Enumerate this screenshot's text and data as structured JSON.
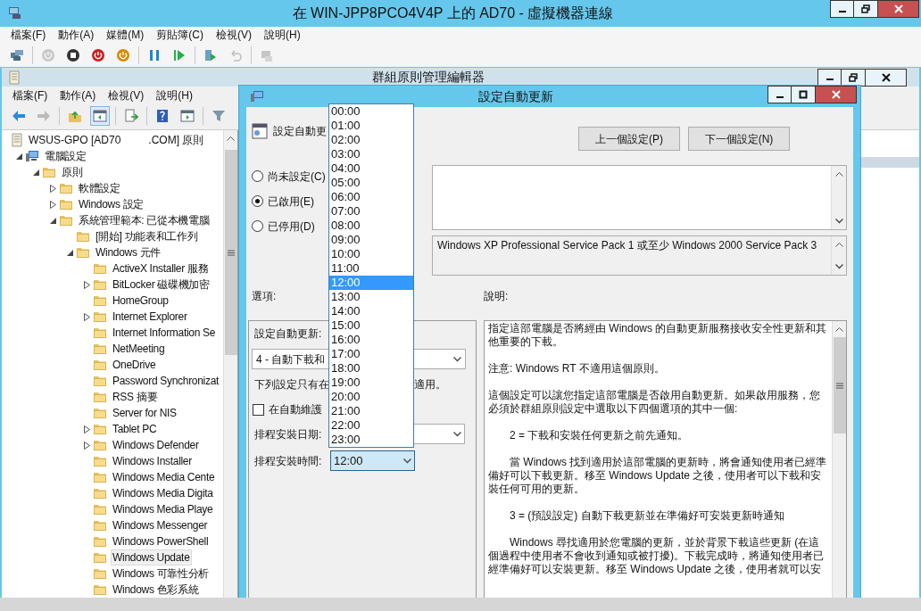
{
  "vm_window": {
    "title": "在 WIN-JPP8PCO4V4P 上的 AD70 - 虛擬機器連線",
    "menu": [
      "檔案(F)",
      "動作(A)",
      "媒體(M)",
      "剪貼簿(C)",
      "檢視(V)",
      "說明(H)"
    ],
    "toolbar": [
      {
        "kind": "ctrl-alt-del",
        "disabled": false
      },
      {
        "kind": "separator"
      },
      {
        "kind": "start",
        "disabled": true
      },
      {
        "kind": "turn-off",
        "disabled": false
      },
      {
        "kind": "shut-down",
        "disabled": false
      },
      {
        "kind": "save",
        "disabled": false
      },
      {
        "kind": "separator"
      },
      {
        "kind": "pause",
        "disabled": false
      },
      {
        "kind": "reset",
        "disabled": false
      },
      {
        "kind": "separator"
      },
      {
        "kind": "checkpoint",
        "disabled": false
      },
      {
        "kind": "revert",
        "disabled": true
      },
      {
        "kind": "separator"
      },
      {
        "kind": "enhanced-session",
        "disabled": true
      }
    ]
  },
  "editor": {
    "title": "群組原則管理編輯器",
    "menu": [
      "檔案(F)",
      "動作(A)",
      "檢視(V)",
      "說明(H)"
    ],
    "toolbar": [
      {
        "kind": "back",
        "disabled": false
      },
      {
        "kind": "forward",
        "disabled": true
      },
      {
        "kind": "separator"
      },
      {
        "kind": "up",
        "disabled": false
      },
      {
        "kind": "tree-toggle",
        "disabled": false
      },
      {
        "kind": "separator"
      },
      {
        "kind": "export",
        "disabled": false
      },
      {
        "kind": "separator"
      },
      {
        "kind": "help",
        "disabled": false
      },
      {
        "kind": "panel",
        "disabled": false
      },
      {
        "kind": "separator"
      },
      {
        "kind": "filter",
        "disabled": false
      }
    ],
    "tree": {
      "name": "WSUS-GPO [AD70",
      "name_suffix": ".COM] 原則",
      "children": [
        {
          "label": "電腦設定",
          "kind": "computer",
          "expanded": true,
          "selected": false,
          "children": [
            {
              "label": "原則",
              "kind": "folder",
              "expanded": true,
              "selected": false,
              "children": [
                {
                  "label": "軟體設定",
                  "kind": "folder",
                  "expanded": false,
                  "selected": false
                },
                {
                  "label": "Windows 設定",
                  "kind": "folder",
                  "expanded": false,
                  "selected": false
                },
                {
                  "label": "系統管理範本: 已從本機電腦",
                  "kind": "folder",
                  "expanded": true,
                  "selected": false,
                  "children": [
                    {
                      "label": "[開始] 功能表和工作列",
                      "kind": "folder",
                      "selected": false
                    },
                    {
                      "label": "Windows 元件",
                      "kind": "folder",
                      "expanded": true,
                      "selected": false,
                      "children": [
                        {
                          "label": "ActiveX Installer 服務",
                          "kind": "folder",
                          "selected": false
                        },
                        {
                          "label": "BitLocker 磁碟機加密",
                          "kind": "folder",
                          "expanded": false,
                          "selected": false
                        },
                        {
                          "label": "HomeGroup",
                          "kind": "folder",
                          "selected": false
                        },
                        {
                          "label": "Internet Explorer",
                          "kind": "folder",
                          "expanded": false,
                          "selected": false
                        },
                        {
                          "label": "Internet Information Se",
                          "kind": "folder",
                          "selected": false
                        },
                        {
                          "label": "NetMeeting",
                          "kind": "folder",
                          "selected": false
                        },
                        {
                          "label": "OneDrive",
                          "kind": "folder",
                          "selected": false
                        },
                        {
                          "label": "Password Synchronizat",
                          "kind": "folder",
                          "selected": false
                        },
                        {
                          "label": "RSS 摘要",
                          "kind": "folder",
                          "selected": false
                        },
                        {
                          "label": "Server for NIS",
                          "kind": "folder",
                          "selected": false
                        },
                        {
                          "label": "Tablet PC",
                          "kind": "folder",
                          "expanded": false,
                          "selected": false
                        },
                        {
                          "label": "Windows Defender",
                          "kind": "folder",
                          "expanded": false,
                          "selected": false
                        },
                        {
                          "label": "Windows Installer",
                          "kind": "folder",
                          "selected": false
                        },
                        {
                          "label": "Windows Media Cente",
                          "kind": "folder",
                          "selected": false
                        },
                        {
                          "label": "Windows Media Digita",
                          "kind": "folder",
                          "selected": false
                        },
                        {
                          "label": "Windows Media Playe",
                          "kind": "folder",
                          "selected": false
                        },
                        {
                          "label": "Windows Messenger",
                          "kind": "folder",
                          "selected": false
                        },
                        {
                          "label": "Windows PowerShell",
                          "kind": "folder",
                          "selected": false
                        },
                        {
                          "label": "Windows Update",
                          "kind": "folder",
                          "selected": true
                        },
                        {
                          "label": "Windows 可靠性分析",
                          "kind": "folder",
                          "selected": false
                        },
                        {
                          "label": "Windows 色彩系統",
                          "kind": "folder",
                          "selected": false
                        }
                      ]
                    }
                  ]
                }
              ]
            }
          ]
        }
      ]
    }
  },
  "dialog": {
    "title": "設定自動更新",
    "setting_name": "設定自動更",
    "nav_buttons": [
      "上一個設定(P)",
      "下一個設定(N)"
    ],
    "states": [
      {
        "label": "尚未設定(C)",
        "selected": false
      },
      {
        "label": "已啟用(E)",
        "selected": true
      },
      {
        "label": "已停用(D)",
        "selected": false
      }
    ],
    "supported_on": "Windows XP Professional Service Pack 1 或至少 Windows 2000 Service Pack 3",
    "options_label": "選項:",
    "help_label": "說明:",
    "options": [
      {
        "kind": "label",
        "text": "設定自動更新:"
      },
      {
        "kind": "select",
        "value": "4 - 自動下載和"
      },
      {
        "kind": "split-text",
        "text": "下列設定只有在",
        "text_2": "適用。"
      },
      {
        "kind": "checkbox",
        "label": "在自動維護",
        "checked": false
      },
      {
        "kind": "labeled-select",
        "label": "排程安裝日期:",
        "focused": false
      },
      {
        "kind": "labeled-select",
        "label": "排程安裝時間:",
        "value": "12:00",
        "focused": true
      }
    ],
    "time_list": [
      {
        "label": "00:00",
        "selected": false
      },
      {
        "label": "01:00",
        "selected": false
      },
      {
        "label": "02:00",
        "selected": false
      },
      {
        "label": "03:00",
        "selected": false
      },
      {
        "label": "04:00",
        "selected": false
      },
      {
        "label": "05:00",
        "selected": false
      },
      {
        "label": "06:00",
        "selected": false
      },
      {
        "label": "07:00",
        "selected": false
      },
      {
        "label": "08:00",
        "selected": false
      },
      {
        "label": "09:00",
        "selected": false
      },
      {
        "label": "10:00",
        "selected": false
      },
      {
        "label": "11:00",
        "selected": false
      },
      {
        "label": "12:00",
        "selected": true
      },
      {
        "label": "13:00",
        "selected": false
      },
      {
        "label": "14:00",
        "selected": false
      },
      {
        "label": "15:00",
        "selected": false
      },
      {
        "label": "16:00",
        "selected": false
      },
      {
        "label": "17:00",
        "selected": false
      },
      {
        "label": "18:00",
        "selected": false
      },
      {
        "label": "19:00",
        "selected": false
      },
      {
        "label": "20:00",
        "selected": false
      },
      {
        "label": "21:00",
        "selected": false
      },
      {
        "label": "22:00",
        "selected": false
      },
      {
        "label": "23:00",
        "selected": false
      }
    ],
    "help": [
      {
        "text": "指定這部電腦是否將經由 Windows 的自動更新服務接收安全性更新和其他重要的下載。",
        "indented": false
      },
      {
        "text": "注意: Windows RT 不適用這個原則。",
        "indented": false
      },
      {
        "text": "這個設定可以讓您指定這部電腦是否啟用自動更新。如果啟用服務，您必須於群組原則設定中選取以下四個選項的其中一個:",
        "indented": false
      },
      {
        "text": "2 = 下載和安裝任何更新之前先通知。",
        "indented": true
      },
      {
        "text": "當 Windows 找到適用於這部電腦的更新時，將會通知使用者已經準備好可以下載更新。移至 Windows Update 之後，使用者可以下載和安裝任何可用的更新。",
        "indented": true
      },
      {
        "text": "3 = (預設設定) 自動下載更新並在準備好可安裝更新時通知",
        "indented": true
      },
      {
        "text": "Windows 尋找適用於您電腦的更新，並於背景下載這些更新 (在這個過程中使用者不會收到通知或被打擾)。下載完成時，將通知使用者已經準備好可以安裝更新。移至 Windows Update 之後，使用者就可以安",
        "indented": true
      }
    ]
  }
}
